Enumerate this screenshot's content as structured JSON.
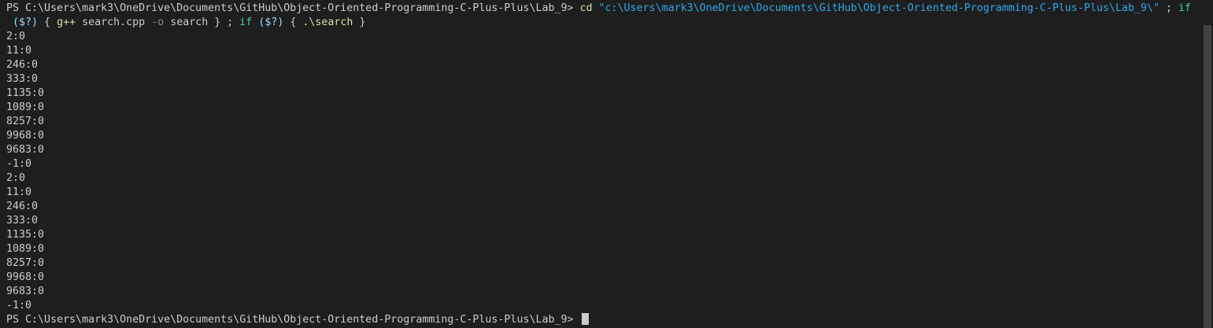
{
  "terminal": {
    "prompt": "PS C:\\Users\\mark3\\OneDrive\\Documents\\GitHub\\Object-Oriented-Programming-C-Plus-Plus\\Lab_9> ",
    "command": {
      "cd": "cd",
      "cd_path": "\"c:\\Users\\mark3\\OneDrive\\Documents\\GitHub\\Object-Oriented-Programming-C-Plus-Plus\\Lab_9\\\"",
      "sep1": " ; ",
      "if1": "if",
      "cont_indent": " ",
      "cond1": "($?)",
      "brace_open1": " { ",
      "gpp": "g++",
      "src": " search.cpp ",
      "flag_o": "-o",
      "out": " search",
      "brace_close1": " } ",
      "sep2": "; ",
      "if2": "if",
      "space": " ",
      "cond2": "($?)",
      "brace_open2": " { ",
      "run": ".\\search",
      "brace_close2": " }"
    },
    "output": [
      "2:0",
      "11:0",
      "246:0",
      "333:0",
      "1135:0",
      "1089:0",
      "8257:0",
      "9968:0",
      "9683:0",
      "-1:0",
      "2:0",
      "11:0",
      "246:0",
      "333:0",
      "1135:0",
      "1089:0",
      "8257:0",
      "9968:0",
      "9683:0",
      "-1:0"
    ],
    "final_prompt": "PS C:\\Users\\mark3\\OneDrive\\Documents\\GitHub\\Object-Oriented-Programming-C-Plus-Plus\\Lab_9> "
  },
  "colors": {
    "background": "#1e1e1e",
    "text": "#cccccc",
    "command": "#dcdcaa",
    "string": "#2ea8e6",
    "keyword": "#4ec9b0",
    "parameter": "#8a8a8a",
    "scrollbar_thumb": "#424242"
  }
}
